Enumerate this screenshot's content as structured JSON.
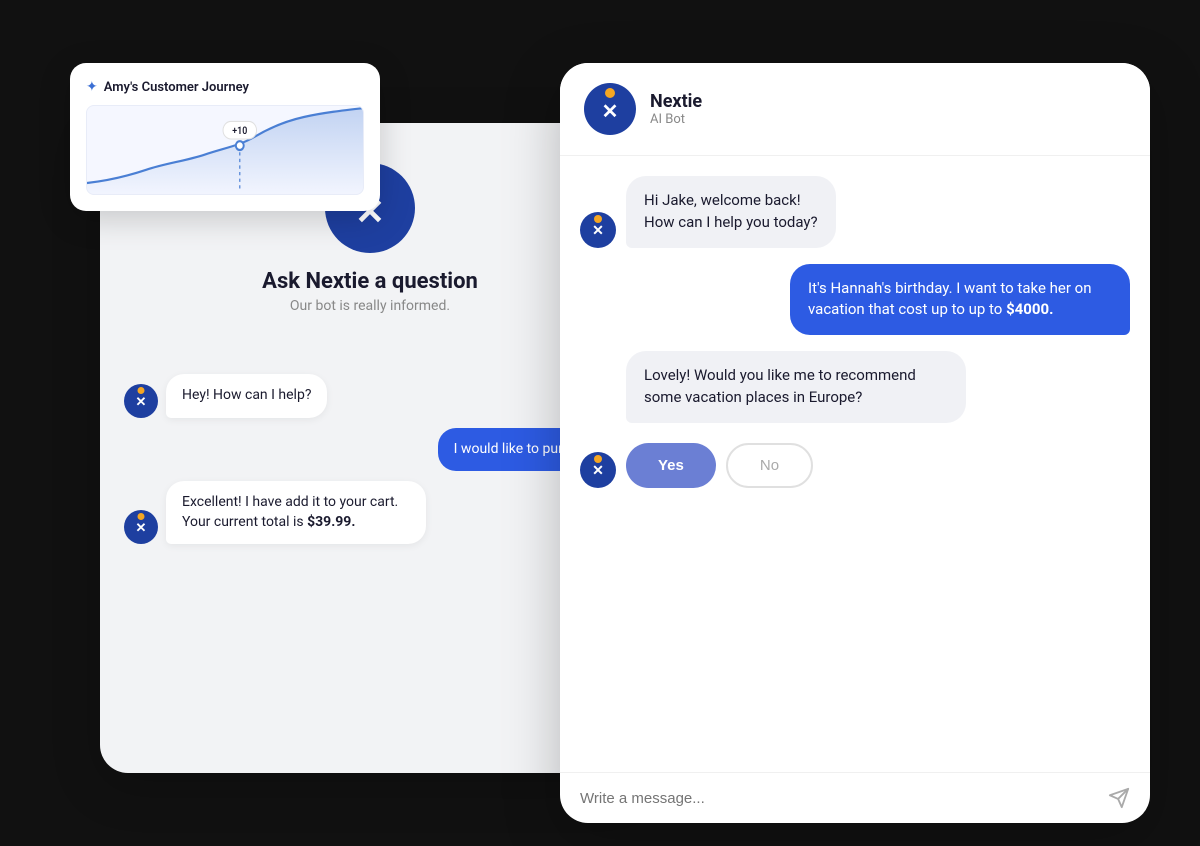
{
  "journey_card": {
    "title": "Amy's Customer Journey",
    "sparkle": "✦",
    "chart_label": "+10"
  },
  "left_panel": {
    "ask_title": "Ask Nextie a question",
    "ask_subtitle": "Our bot is really informed.",
    "messages": [
      {
        "role": "bot",
        "text": "Hey! How can I help?"
      },
      {
        "role": "user",
        "text": "I would like to purchase"
      },
      {
        "role": "bot",
        "text": "Excellent! I have add it to your cart. Your current total is $39.99."
      }
    ]
  },
  "right_panel": {
    "header": {
      "bot_name": "Nextie",
      "bot_role": "AI Bot"
    },
    "messages": [
      {
        "role": "bot",
        "text": "Hi Jake, welcome back!\nHow can I help you today?"
      },
      {
        "role": "user",
        "text": "It's Hannah's birthday. I want to take her on vacation that cost up to up to $4000."
      },
      {
        "role": "bot",
        "text": "Lovely! Would you like me to recommend some vacation places in Europe?",
        "has_yes_no": true
      }
    ],
    "yes_label": "Yes",
    "no_label": "No",
    "input_placeholder": "Write a message..."
  }
}
